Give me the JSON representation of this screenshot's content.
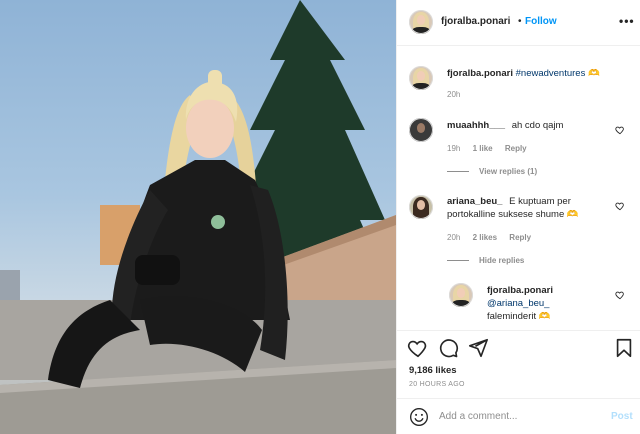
{
  "post": {
    "author": "fjoralba.ponari",
    "follow_separator": "•",
    "follow_label": "Follow",
    "more_label": "•••"
  },
  "caption": {
    "username": "fjoralba.ponari",
    "text": "#newadventures 🫶",
    "time": "20h"
  },
  "comments": [
    {
      "username": "muaahhh___",
      "text": "ah cdo qajm",
      "time": "19h",
      "likes": "1 like",
      "reply": "Reply",
      "view_replies": "View replies (1)"
    },
    {
      "username": "ariana_beu_",
      "text_line1": "E kuptuam per",
      "text_line2": "portokalline suksese shume 🫶",
      "time": "20h",
      "likes": "2 likes",
      "reply": "Reply",
      "view_replies": "Hide replies"
    },
    {
      "username": "fjoralba.ponari",
      "mention": "@ariana_beu_",
      "text": "faleminderit 🫶"
    }
  ],
  "stats": {
    "likes": "9,186 likes",
    "posted": "20 HOURS AGO"
  },
  "add_comment": {
    "placeholder": "Add a comment...",
    "post_label": "Post"
  },
  "icons": [
    "heart-icon",
    "comment-icon",
    "share-icon",
    "bookmark-icon",
    "emoji-icon",
    "more-icon"
  ],
  "colors": {
    "accent": "#0095f6",
    "mention": "#00376b",
    "muted": "#8e8e8e",
    "post_disabled": "#b2dffc"
  }
}
